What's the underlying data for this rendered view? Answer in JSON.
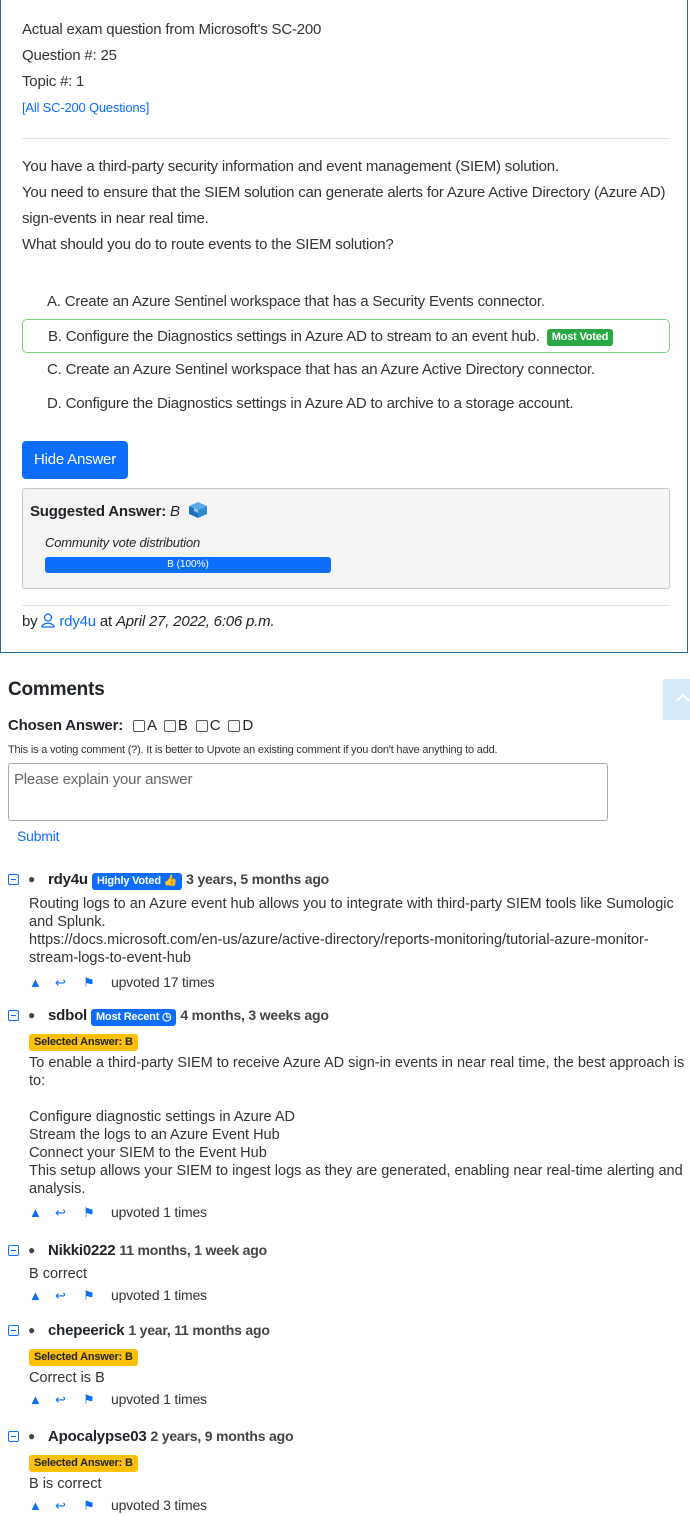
{
  "header": {
    "line1": "Actual exam question from Microsoft's SC-200",
    "line2": "Question #: 25",
    "line3": "Topic #: 1",
    "link": "[All SC-200 Questions]"
  },
  "question": {
    "p1": "You have a third-party security information and event management (SIEM) solution.",
    "p2": "You need to ensure that the SIEM solution can generate alerts for Azure Active Directory (Azure AD) sign-events in near real time.",
    "p3": "What should you do to route events to the SIEM solution?"
  },
  "choices": [
    {
      "text": "A. Create an Azure Sentinel workspace that has a Security Events connector."
    },
    {
      "text": "B. Configure the Diagnostics settings in Azure AD to stream to an event hub.",
      "badge": "Most Voted"
    },
    {
      "text": "C. Create an Azure Sentinel workspace that has an Azure Active Directory connector."
    },
    {
      "text": "D. Configure the Diagnostics settings in Azure AD to archive to a storage account."
    }
  ],
  "hide_button": "Hide Answer",
  "answer": {
    "label": "Suggested Answer:",
    "value": "B",
    "dist_label": "Community vote distribution",
    "bar": "B (100%)",
    "bar_fraction": 1.0
  },
  "byline": {
    "by": "by",
    "user": "rdy4u",
    "at": "at",
    "date": "April 27, 2022, 6:06 p.m."
  },
  "comments_section": {
    "title": "Comments",
    "chosen_label": "Chosen Answer:",
    "options": [
      "A",
      "B",
      "C",
      "D"
    ],
    "note": "This is a voting comment (?). It is better to Upvote an existing comment if you don't have anything to add.",
    "placeholder": "Please explain your answer",
    "submit": "Submit"
  },
  "comments": [
    {
      "user": "rdy4u",
      "tag": "Highly Voted",
      "time": "3 years, 5 months ago",
      "body": "Routing logs to an Azure event hub allows you to integrate with third-party SIEM tools like Sumologic and Splunk.\nhttps://docs.microsoft.com/en-us/azure/active-directory/reports-monitoring/tutorial-azure-monitor-stream-logs-to-event-hub",
      "upvotes": "upvoted 17 times"
    },
    {
      "user": "sdbol",
      "tag": "Most Recent",
      "time": "4 months, 3 weeks ago",
      "selected": "Selected Answer: B",
      "body": "To enable a third-party SIEM to receive Azure AD sign-in events in near real time, the best approach is to:\n\nConfigure diagnostic settings in Azure AD\nStream the logs to an Azure Event Hub\nConnect your SIEM to the Event Hub\nThis setup allows your SIEM to ingest logs as they are generated, enabling near real-time alerting and analysis.",
      "upvotes": "upvoted 1 times"
    },
    {
      "user": "Nikki0222",
      "time": "11 months, 1 week ago",
      "body": "B correct",
      "upvotes": "upvoted 1 times"
    },
    {
      "user": "chepeerick",
      "time": "1 year, 11 months ago",
      "selected": "Selected Answer: B",
      "body": "Correct is B",
      "upvotes": "upvoted 1 times"
    },
    {
      "user": "Apocalypse03",
      "time": "2 years, 9 months ago",
      "selected": "Selected Answer: B",
      "body": "B is correct",
      "upvotes": "upvoted 3 times"
    }
  ]
}
